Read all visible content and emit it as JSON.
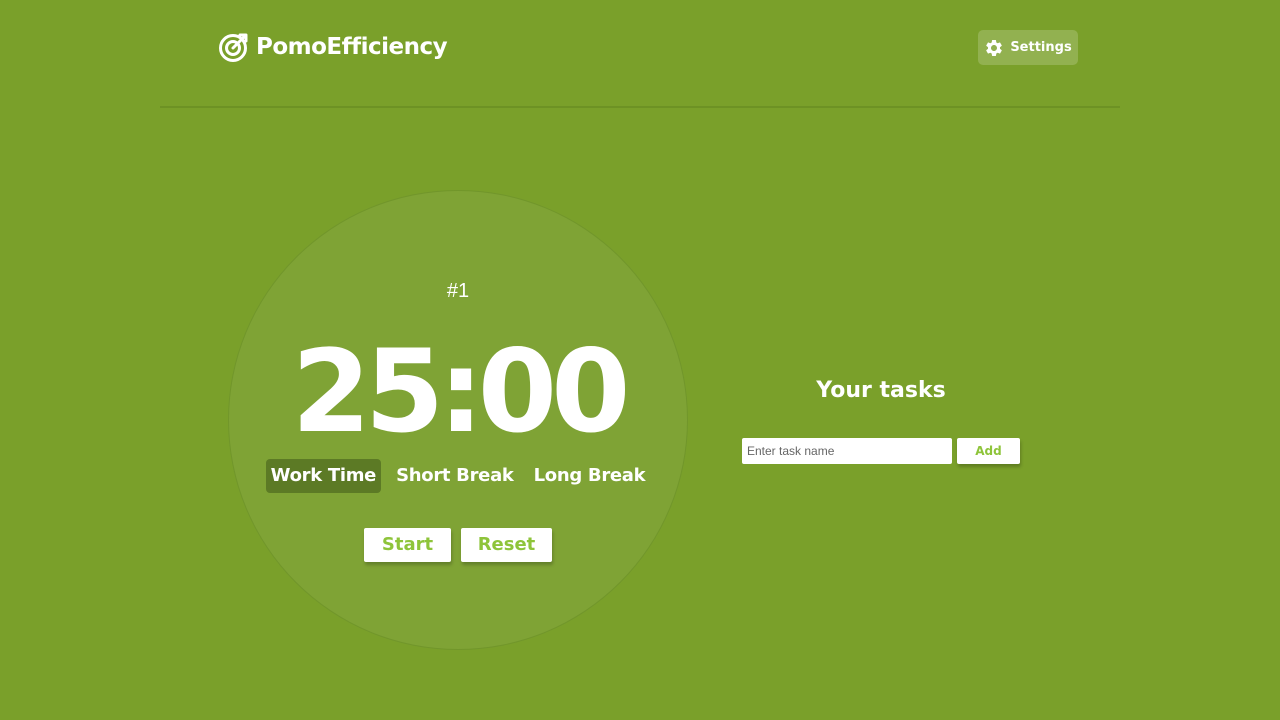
{
  "app": {
    "name": "PomoEfficiency",
    "logo_icon": "target-icon"
  },
  "header": {
    "settings_label": "Settings",
    "settings_icon": "gear-icon"
  },
  "timer": {
    "session_number": "#1",
    "display": "25:00",
    "modes": [
      {
        "label": "Work Time",
        "active": true
      },
      {
        "label": "Short Break",
        "active": false
      },
      {
        "label": "Long Break",
        "active": false
      }
    ],
    "start_label": "Start",
    "reset_label": "Reset"
  },
  "tasks": {
    "title": "Your tasks",
    "input_placeholder": "Enter task name",
    "input_value": "",
    "add_label": "Add"
  },
  "colors": {
    "background": "#7aa02a",
    "timer_circle": "#7fa335",
    "active_mode": "#5c7a25",
    "button_text": "#8ec43a"
  }
}
